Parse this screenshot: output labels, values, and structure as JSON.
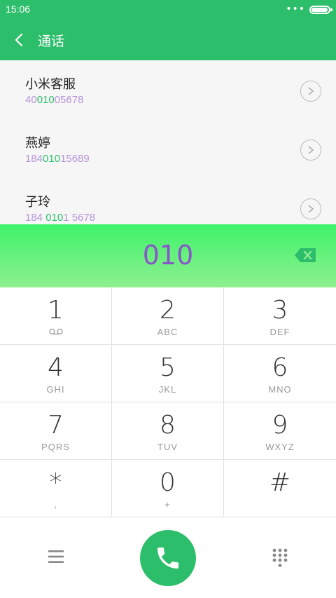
{
  "status_bar": {
    "time": "15:06",
    "dots": "•••",
    "battery_level": 0.95
  },
  "header": {
    "title": "通话",
    "back_icon": "chevron-left-icon"
  },
  "results": [
    {
      "name": "小米客服",
      "number_parts": [
        {
          "text": "40",
          "highlight": false
        },
        {
          "text": "010",
          "highlight": true
        },
        {
          "text": "05678",
          "highlight": false
        }
      ]
    },
    {
      "name": "燕婷",
      "number_parts": [
        {
          "text": "184",
          "highlight": false
        },
        {
          "text": "010",
          "highlight": true
        },
        {
          "text": "15689",
          "highlight": false
        }
      ]
    },
    {
      "name": "子玲",
      "number_parts": [
        {
          "text": "184 ",
          "highlight": false
        },
        {
          "text": "010",
          "highlight": true
        },
        {
          "text": "1 5678",
          "highlight": false
        }
      ]
    }
  ],
  "display": {
    "number": "010",
    "backspace_icon": "backspace-icon"
  },
  "keypad": [
    {
      "digit": "1",
      "letters": "",
      "sub_icon": "voicemail-icon"
    },
    {
      "digit": "2",
      "letters": "ABC"
    },
    {
      "digit": "3",
      "letters": "DEF"
    },
    {
      "digit": "4",
      "letters": "GHI"
    },
    {
      "digit": "5",
      "letters": "JKL"
    },
    {
      "digit": "6",
      "letters": "MNO"
    },
    {
      "digit": "7",
      "letters": "PQRS"
    },
    {
      "digit": "8",
      "letters": "TUV"
    },
    {
      "digit": "9",
      "letters": "WXYZ"
    },
    {
      "digit": "*",
      "letters": ","
    },
    {
      "digit": "0",
      "letters": "+"
    },
    {
      "digit": "#",
      "letters": ""
    }
  ],
  "bottom_bar": {
    "menu_icon": "menu-icon",
    "call_icon": "phone-icon",
    "dialpad_icon": "dialpad-icon"
  },
  "colors": {
    "accent": "#2dbe6c",
    "display_text": "#8a55c8",
    "match_highlight": "#2dbe6c",
    "number_text": "#b694d9"
  }
}
